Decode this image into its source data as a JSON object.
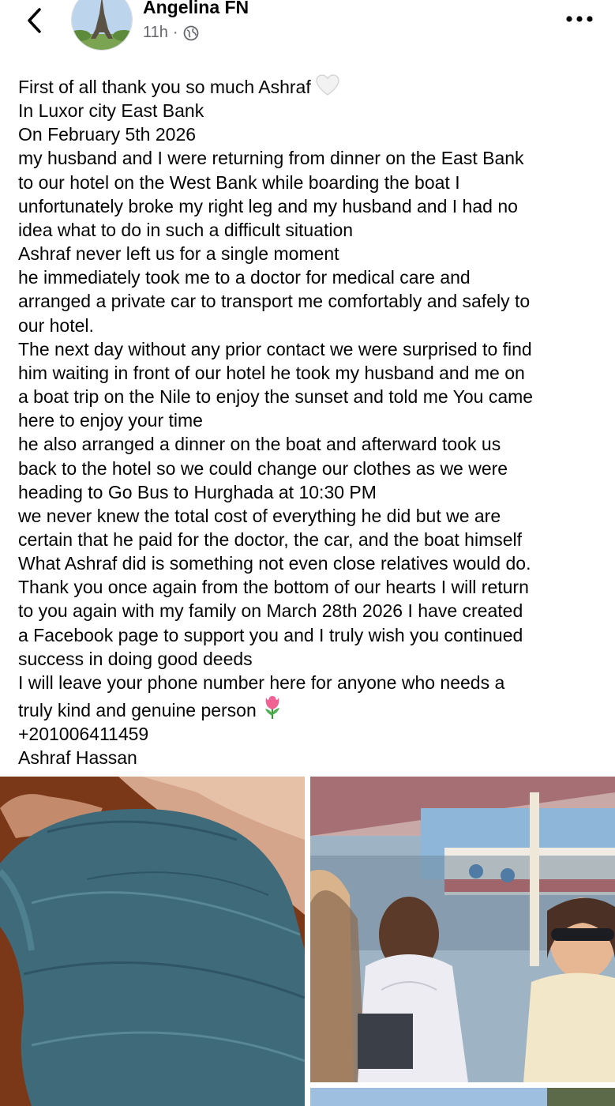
{
  "post": {
    "author": "Angelina FN",
    "time": "11h",
    "separator": "·",
    "audience_icon": "globe-icon"
  },
  "body_lines": [
    "First of all thank you so much Ashraf",
    "In Luxor city East Bank",
    "On February 5th 2026",
    "my husband and I were returning from dinner on the East Bank",
    "to our hotel on the West Bank while boarding the boat I",
    "unfortunately broke my right leg and my husband and I had no",
    "idea what to do in such a difficult situation",
    "Ashraf never left us for a single moment",
    "he immediately took me to a doctor for medical care and",
    "arranged a private car to transport me comfortably and safely to",
    "our hotel.",
    "The next day without any prior contact we were surprised to find",
    "him waiting in front of our hotel he took my husband and me on",
    "a boat trip on the Nile to enjoy the sunset and told me You came",
    "here to enjoy your time",
    "he also arranged a dinner on the boat and afterward took us",
    "back to the hotel so we could change our clothes as we were",
    "heading to Go Bus to Hurghada at 10:30 PM",
    "we never knew the total cost of everything he did but we are",
    "certain that he paid for the doctor, the car, and the boat himself",
    "What Ashraf did is something not even close relatives would do.",
    "Thank you once again from the bottom of our hearts I will return",
    "to you again with my family on March 28th 2026 I have created",
    "a Facebook page to support you and I truly wish you continued",
    "success in doing good deeds",
    "I will leave your phone number here for anyone who needs a",
    "truly kind and genuine person",
    "+201006411459",
    "Ashraf Hassan"
  ],
  "icons": {
    "back": "chevron-left-icon",
    "more": "more-options-icon",
    "heart": "white-heart-emoji",
    "tulip": "tulip-emoji"
  },
  "colors": {
    "text": "#050505",
    "secondary": "#65676b",
    "cast": "#3e6a7a"
  }
}
